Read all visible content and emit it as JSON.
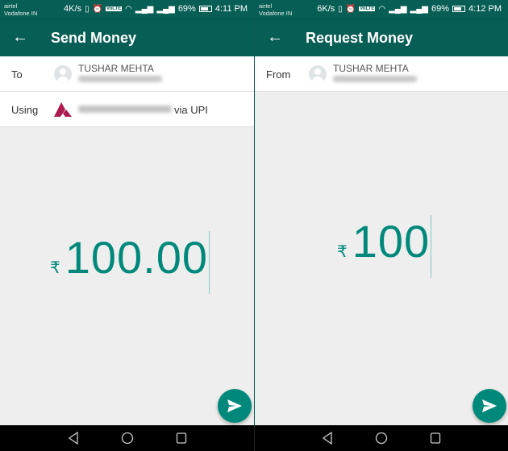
{
  "screens": [
    {
      "status": {
        "carrier1": "airtel",
        "carrier2": "Vodafone IN",
        "speed": "4K/s",
        "battery": "69%",
        "time": "4:11 PM",
        "volte": "VoLTE"
      },
      "title": "Send Money",
      "to_label": "To",
      "recipient_name": "TUSHAR MEHTA",
      "using_label": "Using",
      "via_text": "via UPI",
      "currency": "₹",
      "amount": "100.00"
    },
    {
      "status": {
        "carrier1": "airtel",
        "carrier2": "Vodafone IN",
        "speed": "6K/s",
        "battery": "69%",
        "time": "4:12 PM",
        "volte": "VoLTE"
      },
      "title": "Request Money",
      "from_label": "From",
      "recipient_name": "TUSHAR MEHTA",
      "currency": "₹",
      "amount": "100"
    }
  ],
  "icons": {
    "back": "arrow-left-icon",
    "send": "send-icon",
    "nav_back": "triangle-back-icon",
    "nav_home": "circle-home-icon",
    "nav_recents": "square-recents-icon"
  },
  "colors": {
    "primary_dark": "#075e54",
    "accent": "#00897b",
    "bank": "#ae1a4f"
  }
}
